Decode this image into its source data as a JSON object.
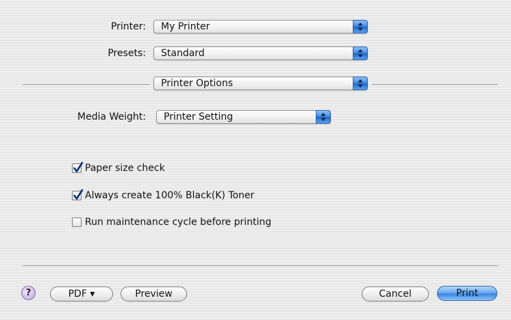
{
  "printer": {
    "label": "Printer:",
    "value": "My Printer"
  },
  "presets": {
    "label": "Presets:",
    "value": "Standard"
  },
  "panel": {
    "value": "Printer Options"
  },
  "media_weight": {
    "label": "Media Weight:",
    "value": "Printer Setting"
  },
  "options": [
    {
      "label": "Paper size check",
      "checked": true
    },
    {
      "label": "Always create 100% Black(K) Toner",
      "checked": true
    },
    {
      "label": "Run maintenance cycle before printing",
      "checked": false
    }
  ],
  "buttons": {
    "help": "?",
    "pdf": "PDF ▾",
    "preview": "Preview",
    "cancel": "Cancel",
    "print": "Print"
  },
  "colors": {
    "accent": "#3a86e0"
  }
}
